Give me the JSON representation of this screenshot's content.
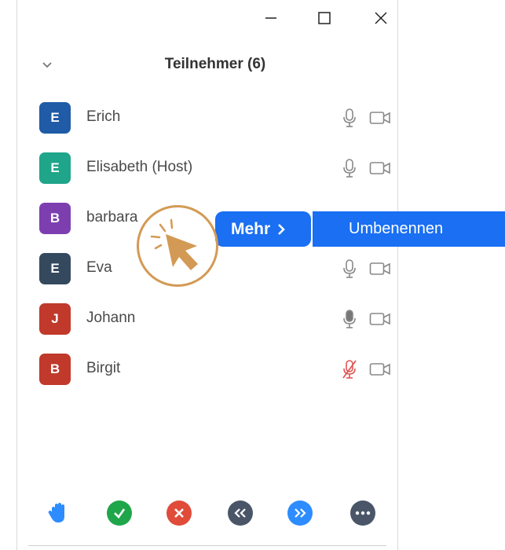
{
  "header": {
    "title": "Teilnehmer (6)"
  },
  "participants": [
    {
      "initial": "E",
      "name": "Erich",
      "color": "#1f5ba6",
      "audio": "on"
    },
    {
      "initial": "E",
      "name": "Elisabeth (Host)",
      "color": "#1fa58a",
      "audio": "on"
    },
    {
      "initial": "B",
      "name": "barbara",
      "color": "#7d3fb0",
      "audio": "hidden"
    },
    {
      "initial": "E",
      "name": "Eva",
      "color": "#34495e",
      "audio": "on"
    },
    {
      "initial": "J",
      "name": "Johann",
      "color": "#c0392b",
      "audio": "speaking"
    },
    {
      "initial": "B",
      "name": "Birgit",
      "color": "#c0392b",
      "audio": "muted"
    }
  ],
  "context_menu": {
    "more_label": "Mehr",
    "rename_label": "Umbenennen"
  },
  "colors": {
    "accent": "#1a6ff2",
    "cursor": "#d39a55"
  }
}
